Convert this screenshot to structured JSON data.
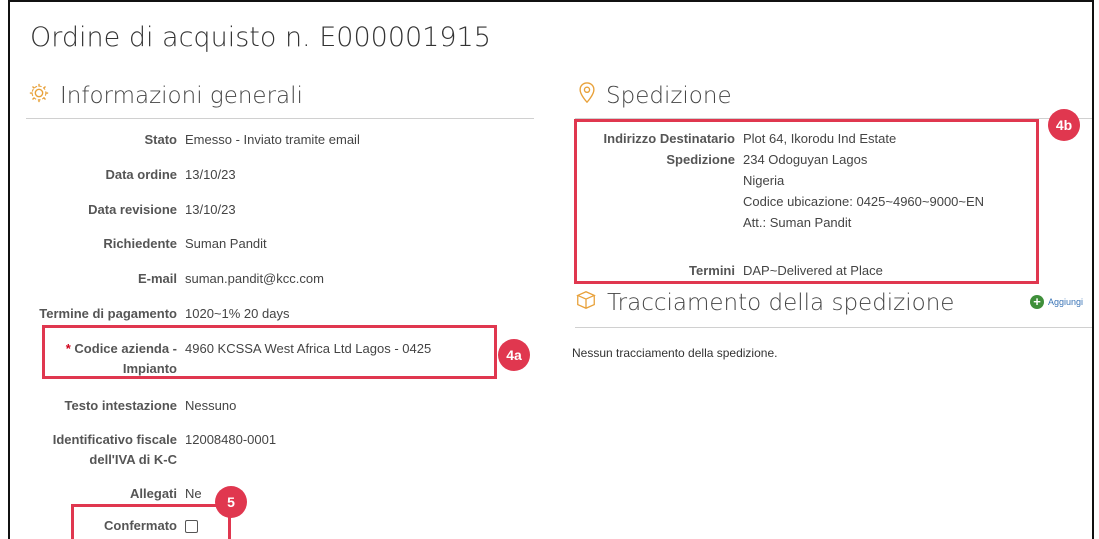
{
  "page": {
    "title": "Ordine di acquisto n. E000001915"
  },
  "general": {
    "heading": "Informazioni generali",
    "icon": "gear-icon",
    "fields": [
      {
        "label": "Stato",
        "value": "Emesso - Inviato tramite email"
      },
      {
        "label": "Data ordine",
        "value": "13/10/23"
      },
      {
        "label": "Data revisione",
        "value": "13/10/23"
      },
      {
        "label": "Richiedente",
        "value": "Suman Pandit"
      },
      {
        "label": "E-mail",
        "value": "suman.pandit@kcc.com"
      },
      {
        "label": "Termine di pagamento",
        "value": "1020~1% 20 days"
      },
      {
        "label_req": "*",
        "label_line1": "Codice azienda -",
        "label_line2": "Impianto",
        "value": "4960 KCSSA West Africa Ltd Lagos - 0425"
      },
      {
        "label": "Testo intestazione",
        "value": "Nessuno"
      },
      {
        "label_line1": "Identificativo fiscale",
        "label_line2": "dell'IVA di K-C",
        "value": "12008480-0001"
      },
      {
        "label": "Allegati",
        "value": "Ne"
      },
      {
        "label": "Confermato",
        "checked": false
      }
    ]
  },
  "shipping": {
    "heading": "Spedizione",
    "icon": "location-pin-icon",
    "address_label_line1": "Indirizzo Destinatario",
    "address_label_line2": "Spedizione",
    "address_lines": [
      "Plot 64, Ikorodu Ind Estate",
      "234 Odoguyan Lagos",
      "Nigeria",
      "Codice ubicazione: 0425~4960~9000~EN",
      "Att.: Suman Pandit"
    ],
    "terms_label": "Termini",
    "terms_value": "DAP~Delivered at Place"
  },
  "tracking": {
    "heading": "Tracciamento della spedizione",
    "icon": "box-icon",
    "add_label": "Aggiungi",
    "empty_text": "Nessun tracciamento della spedizione."
  },
  "annotations": {
    "badge_4a": "4a",
    "badge_4b": "4b",
    "badge_5": "5"
  },
  "colors": {
    "highlight": "#e0374f",
    "icon_orange": "#e8a13a",
    "add_green": "#3f8f3a"
  }
}
